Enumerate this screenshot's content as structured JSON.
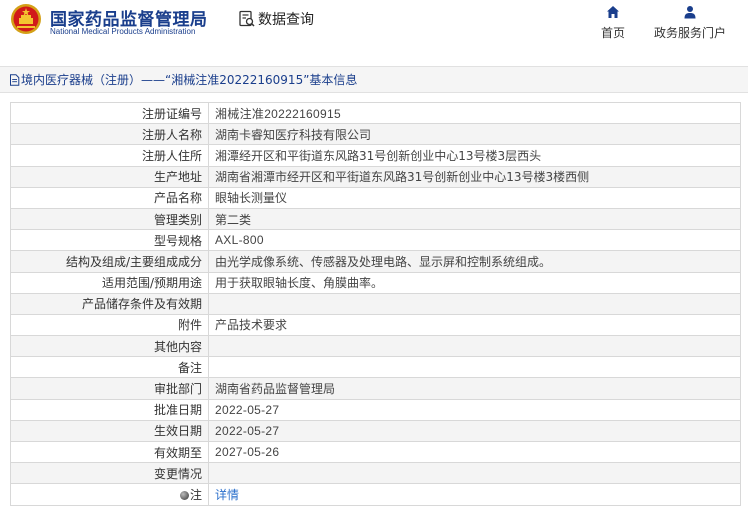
{
  "header": {
    "site_title": "国家药品监督管理局",
    "site_subtitle": "National Medical Products Administration",
    "data_query_label": "数据查询",
    "nav_home_label": "首页",
    "nav_service_label": "政务服务门户",
    "emblem_icon": "national-emblem-icon",
    "accent_color": "#1a3e8c"
  },
  "breadcrumb": {
    "text": "境内医疗器械（注册）——“湘械注准20222160915”基本信息"
  },
  "detail": {
    "rows": [
      {
        "label": "注册证编号",
        "value": "湘械注准20222160915"
      },
      {
        "label": "注册人名称",
        "value": "湖南卡睿知医疗科技有限公司"
      },
      {
        "label": "注册人住所",
        "value": "湘潭经开区和平街道东风路31号创新创业中心13号楼3层西头"
      },
      {
        "label": "生产地址",
        "value": "湖南省湘潭市经开区和平街道东风路31号创新创业中心13号楼3楼西侧"
      },
      {
        "label": "产品名称",
        "value": "眼轴长测量仪"
      },
      {
        "label": "管理类别",
        "value": "第二类"
      },
      {
        "label": "型号规格",
        "value": "AXL-800"
      },
      {
        "label": "结构及组成/主要组成成分",
        "value": "由光学成像系统、传感器及处理电路、显示屏和控制系统组成。"
      },
      {
        "label": "适用范围/预期用途",
        "value": "用于获取眼轴长度、角膜曲率。"
      },
      {
        "label": "产品储存条件及有效期",
        "value": ""
      },
      {
        "label": "附件",
        "value": "产品技术要求"
      },
      {
        "label": "其他内容",
        "value": ""
      },
      {
        "label": "备注",
        "value": ""
      },
      {
        "label": "审批部门",
        "value": "湖南省药品监督管理局"
      },
      {
        "label": "批准日期",
        "value": "2022-05-27"
      },
      {
        "label": "生效日期",
        "value": "2022-05-27"
      },
      {
        "label": "有效期至",
        "value": "2027-05-26"
      },
      {
        "label": "变更情况",
        "value": ""
      },
      {
        "label": "注",
        "value": "详情"
      }
    ]
  }
}
